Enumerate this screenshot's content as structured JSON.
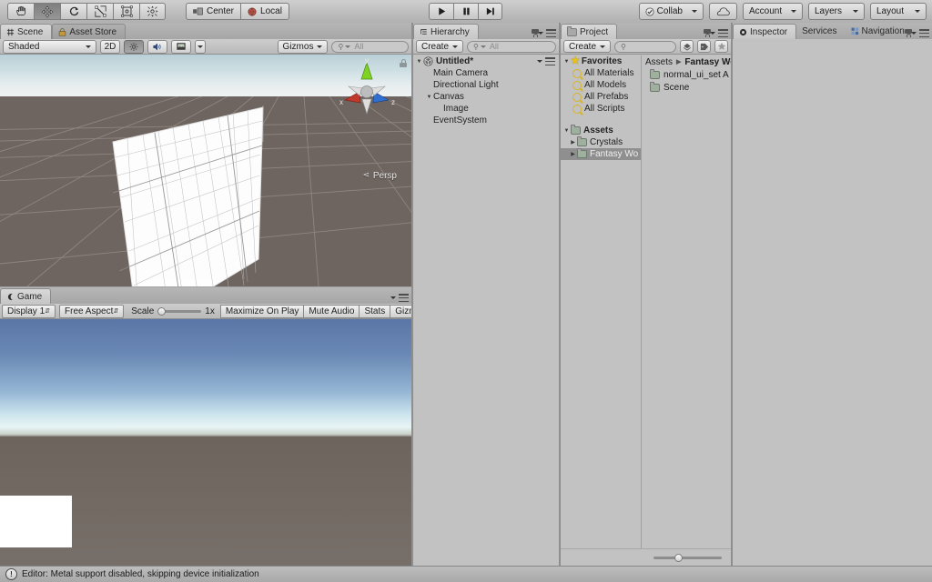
{
  "toolbar": {
    "tools": [
      {
        "name": "hand-tool",
        "label": "Hand",
        "active": false
      },
      {
        "name": "move-tool",
        "label": "Move",
        "active": true
      },
      {
        "name": "rotate-tool",
        "label": "Rotate",
        "active": false
      },
      {
        "name": "scale-tool",
        "label": "Scale",
        "active": false
      },
      {
        "name": "rect-tool",
        "label": "Rect",
        "active": false
      },
      {
        "name": "transform-tool",
        "label": "Transform",
        "active": false
      }
    ],
    "pivot_label": "Center",
    "pivot_rotation_label": "Local",
    "play_label": "Play",
    "pause_label": "Pause",
    "step_label": "Step",
    "collab_label": "Collab",
    "cloud_label": "Cloud",
    "account_label": "Account",
    "layers_label": "Layers",
    "layout_label": "Layout"
  },
  "scene_panel": {
    "tabs": [
      {
        "label": "Scene",
        "icon": "grid-icon",
        "active": true
      },
      {
        "label": "Asset Store",
        "icon": "store-icon",
        "active": false
      }
    ],
    "draw_mode": "Shaded",
    "mode_2d": "2D",
    "lighting_label": "Lighting",
    "audio_label": "Audio",
    "effects_label": "Effects",
    "gizmos_label": "Gizmos",
    "search_placeholder": "All",
    "search_value": "",
    "projection_label": "Persp",
    "axis_x": "x",
    "axis_y": "y",
    "axis_z": "z"
  },
  "game_panel": {
    "tab_label": "Game",
    "display": "Display 1",
    "aspect": "Free Aspect",
    "scale_label": "Scale",
    "scale_value": "1x",
    "maximize_label": "Maximize On Play",
    "mute_label": "Mute Audio",
    "stats_label": "Stats",
    "gizmos_label": "Gizmos"
  },
  "hierarchy": {
    "tab_label": "Hierarchy",
    "create_label": "Create",
    "search_placeholder": "All",
    "search_value": "",
    "items": [
      {
        "label": "Untitled*",
        "depth": 0,
        "arrow": "down",
        "icon": "unity-scene-icon",
        "bold": true
      },
      {
        "label": "Main Camera",
        "depth": 1,
        "arrow": "none",
        "icon": "none",
        "bold": false
      },
      {
        "label": "Directional Light",
        "depth": 1,
        "arrow": "none",
        "icon": "none",
        "bold": false
      },
      {
        "label": "Canvas",
        "depth": 1,
        "arrow": "down",
        "icon": "none",
        "bold": false
      },
      {
        "label": "Image",
        "depth": 2,
        "arrow": "none",
        "icon": "none",
        "bold": false
      },
      {
        "label": "EventSystem",
        "depth": 1,
        "arrow": "none",
        "icon": "none",
        "bold": false
      }
    ]
  },
  "project": {
    "tab_label": "Project",
    "create_label": "Create",
    "search_placeholder": "",
    "search_value": "",
    "filter_type_label": "Type Filter",
    "filter_label_label": "Label Filter",
    "filter_favorite_label": "Favorites Filter",
    "tree": [
      {
        "label": "Favorites",
        "depth": 0,
        "arrow": "down",
        "icon": "star-icon",
        "bold": true,
        "selected": false
      },
      {
        "label": "All Materials",
        "depth": 1,
        "arrow": "none",
        "icon": "search-icon",
        "bold": false,
        "selected": false
      },
      {
        "label": "All Models",
        "depth": 1,
        "arrow": "none",
        "icon": "search-icon",
        "bold": false,
        "selected": false
      },
      {
        "label": "All Prefabs",
        "depth": 1,
        "arrow": "none",
        "icon": "search-icon",
        "bold": false,
        "selected": false
      },
      {
        "label": "All Scripts",
        "depth": 1,
        "arrow": "none",
        "icon": "search-icon",
        "bold": false,
        "selected": false
      },
      {
        "label": "Assets",
        "depth": 0,
        "arrow": "down",
        "icon": "folder-icon",
        "bold": true,
        "selected": false
      },
      {
        "label": "Crystals",
        "depth": 1,
        "arrow": "right",
        "icon": "folder-icon",
        "bold": false,
        "selected": false
      },
      {
        "label": "Fantasy Wo",
        "depth": 1,
        "arrow": "right",
        "icon": "folder-icon",
        "bold": false,
        "selected": true
      }
    ],
    "breadcrumb": [
      "Assets",
      "Fantasy Wo"
    ],
    "contents": [
      {
        "label": "normal_ui_set A",
        "icon": "folder-icon"
      },
      {
        "label": "Scene",
        "icon": "folder-icon"
      }
    ],
    "zoom_slider_value": 35
  },
  "inspector": {
    "tabs": [
      {
        "label": "Inspector",
        "icon": "inspector-icon",
        "active": true
      },
      {
        "label": "Services",
        "icon": "none",
        "active": false
      },
      {
        "label": "Navigation",
        "icon": "navigation-icon",
        "active": false
      }
    ]
  },
  "status_bar": {
    "icon": "warning-icon",
    "message": "Editor: Metal support disabled, skipping device initialization"
  }
}
